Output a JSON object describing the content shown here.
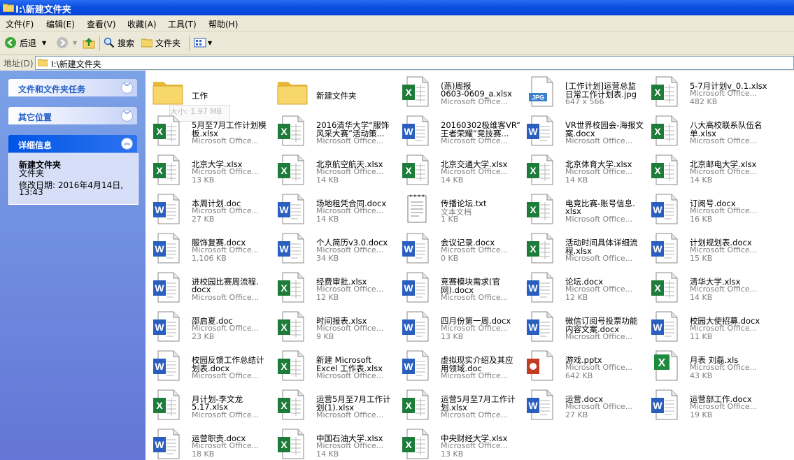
{
  "window": {
    "title": "I:\\新建文件夹"
  },
  "menu": [
    "文件(F)",
    "编辑(E)",
    "查看(V)",
    "收藏(A)",
    "工具(T)",
    "帮助(H)"
  ],
  "toolbar": {
    "back": "后退",
    "search": "搜索",
    "folders": "文件夹"
  },
  "address": {
    "label": "地址(D)",
    "path": "I:\\新建文件夹"
  },
  "tooltip": "大小: 1.97 MB",
  "sidebar": {
    "tasks_title": "文件和文件夹任务",
    "other_title": "其它位置",
    "details_title": "详细信息",
    "details_name": "新建文件夹",
    "details_type": "文件夹",
    "details_modified_1": "修改日期: 2016年4月14日,",
    "details_modified_2": "13:43"
  },
  "colors": {
    "title_blue": "#0a4fe0",
    "sidebar_blue": "#6e8ce0",
    "excel_green": "#1e7c3a",
    "word_blue": "#2a5fbf",
    "ppt_red": "#c23b22"
  },
  "files": [
    {
      "icon": "folder",
      "lines": [
        "工作"
      ]
    },
    {
      "icon": "folder",
      "lines": [
        "新建文件夹"
      ]
    },
    {
      "icon": "excel",
      "lines": [
        "(燕)周报",
        "0603-0609_a.xlsx",
        "Microsoft Office..."
      ]
    },
    {
      "icon": "jpg",
      "lines": [
        "[工作计划]运营总监",
        "日常工作计划表.jpg",
        "647 x 566"
      ]
    },
    {
      "icon": "excel",
      "lines": [
        "5-7月计划v_0.1.xlsx",
        "Microsoft Office...",
        "482 KB"
      ]
    },
    {
      "icon": "excel",
      "lines": [
        "5月至7月工作计划模",
        "板.xlsx",
        "Microsoft Office..."
      ]
    },
    {
      "icon": "excel",
      "lines": [
        "2016清华大学“服饰",
        "风采大赛”活动策...",
        "Microsoft Office..."
      ]
    },
    {
      "icon": "word",
      "lines": [
        "20160302极维客VR“",
        "王者荣耀”竞技赛...",
        "Microsoft Office..."
      ]
    },
    {
      "icon": "word",
      "lines": [
        "VR世界校园会-海报文",
        "案.docx",
        "Microsoft Office..."
      ]
    },
    {
      "icon": "excel",
      "lines": [
        "八大高校联系队伍名",
        "单.xlsx",
        "Microsoft Office..."
      ]
    },
    {
      "icon": "excel",
      "lines": [
        "北京大学.xlsx",
        "Microsoft Office...",
        "13 KB"
      ]
    },
    {
      "icon": "excel",
      "lines": [
        "北京航空航天.xlsx",
        "Microsoft Office...",
        "14 KB"
      ]
    },
    {
      "icon": "excel",
      "lines": [
        "北京交通大学.xlsx",
        "Microsoft Office...",
        "14 KB"
      ]
    },
    {
      "icon": "excel",
      "lines": [
        "北京体育大学.xlsx",
        "Microsoft Office...",
        "14 KB"
      ]
    },
    {
      "icon": "excel",
      "lines": [
        "北京邮电大学.xlsx",
        "Microsoft Office...",
        "14 KB"
      ]
    },
    {
      "icon": "word",
      "lines": [
        "本周计划.doc",
        "Microsoft Office...",
        "27 KB"
      ]
    },
    {
      "icon": "word",
      "lines": [
        "场地租凭合同.docx",
        "Microsoft Office...",
        "14 KB"
      ]
    },
    {
      "icon": "txt",
      "lines": [
        "传播论坛.txt",
        "文本文档",
        "1 KB"
      ]
    },
    {
      "icon": "excel",
      "lines": [
        "电竞比赛-账号信息.",
        "xlsx",
        "Microsoft Office..."
      ]
    },
    {
      "icon": "word",
      "lines": [
        "订阅号.docx",
        "Microsoft Office...",
        "16 KB"
      ]
    },
    {
      "icon": "word",
      "lines": [
        "服饰复赛.docx",
        "Microsoft Office...",
        "1,106 KB"
      ]
    },
    {
      "icon": "word",
      "lines": [
        "个人简历v3.0.docx",
        "Microsoft Office...",
        "34 KB"
      ]
    },
    {
      "icon": "word",
      "lines": [
        "会议记录.docx",
        "Microsoft Office...",
        "0 KB"
      ]
    },
    {
      "icon": "excel",
      "lines": [
        "活动时间具体详细流",
        "程.xlsx",
        "Microsoft Office..."
      ]
    },
    {
      "icon": "word",
      "lines": [
        "计划规划表.docx",
        "Microsoft Office...",
        "15 KB"
      ]
    },
    {
      "icon": "word",
      "lines": [
        "进校园比赛周流程.",
        "docx",
        "Microsoft Office..."
      ]
    },
    {
      "icon": "excel",
      "lines": [
        "经费审批.xlsx",
        "Microsoft Office...",
        "12 KB"
      ]
    },
    {
      "icon": "word",
      "lines": [
        "竞赛模块需求(官",
        "网).docx",
        "Microsoft Office..."
      ]
    },
    {
      "icon": "word",
      "lines": [
        "论坛.docx",
        "Microsoft Office...",
        "12 KB"
      ]
    },
    {
      "icon": "excel",
      "lines": [
        "清华大学.xlsx",
        "Microsoft Office...",
        "14 KB"
      ]
    },
    {
      "icon": "word",
      "lines": [
        "邵启夏.doc",
        "Microsoft Office...",
        "23 KB"
      ]
    },
    {
      "icon": "excel",
      "lines": [
        "时间报表.xlsx",
        "Microsoft Office...",
        "9 KB"
      ]
    },
    {
      "icon": "word",
      "lines": [
        "四月份第一周.docx",
        "Microsoft Office...",
        "13 KB"
      ]
    },
    {
      "icon": "word",
      "lines": [
        "微信订阅号投票功能",
        "内容文案.docx",
        "Microsoft Office..."
      ]
    },
    {
      "icon": "word",
      "lines": [
        "校园大使招募.docx",
        "Microsoft Office...",
        "11 KB"
      ]
    },
    {
      "icon": "word",
      "lines": [
        "校园反馈工作总结计",
        "划表.docx",
        "Microsoft Office..."
      ]
    },
    {
      "icon": "excel",
      "lines": [
        "新建 Microsoft",
        "Excel 工作表.xlsx",
        "Microsoft Office..."
      ]
    },
    {
      "icon": "word",
      "lines": [
        "虚拟现实介绍及其应",
        "用领域.doc",
        "Microsoft Office..."
      ]
    },
    {
      "icon": "ppt",
      "lines": [
        "游戏.pptx",
        "Microsoft Office...",
        "642 KB"
      ]
    },
    {
      "icon": "xls",
      "lines": [
        "月表 刘磊.xls",
        "Microsoft Office...",
        "43 KB"
      ]
    },
    {
      "icon": "excel",
      "lines": [
        "月计划-李文龙",
        "5.17.xlsx",
        "Microsoft Office..."
      ]
    },
    {
      "icon": "excel",
      "lines": [
        "运营5月至7月工作计",
        "划(1).xlsx",
        "Microsoft Office..."
      ]
    },
    {
      "icon": "excel",
      "lines": [
        "运营5月至7月工作计",
        "划.xlsx",
        "Microsoft Office..."
      ]
    },
    {
      "icon": "word",
      "lines": [
        "运营.docx",
        "Microsoft Office...",
        "27 KB"
      ]
    },
    {
      "icon": "word",
      "lines": [
        "运营部工作.docx",
        "Microsoft Office...",
        "19 KB"
      ]
    },
    {
      "icon": "word",
      "lines": [
        "运营职责.docx",
        "Microsoft Office...",
        "18 KB"
      ]
    },
    {
      "icon": "excel",
      "lines": [
        "中国石油大学.xlsx",
        "Microsoft Office...",
        "14 KB"
      ]
    },
    {
      "icon": "excel",
      "lines": [
        "中央财经大学.xlsx",
        "Microsoft Office...",
        "13 KB"
      ]
    }
  ]
}
